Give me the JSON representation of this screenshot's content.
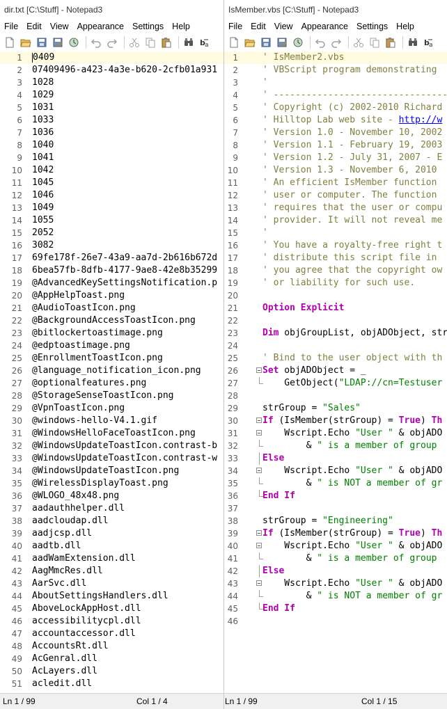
{
  "left": {
    "title": "dir.txt [C:\\Stuff] - Notepad3",
    "menu": [
      "File",
      "Edit",
      "View",
      "Appearance",
      "Settings",
      "Help"
    ],
    "status": {
      "line": "Ln 1 / 99",
      "col": "Col 1 / 4"
    },
    "lines": [
      {
        "n": "1",
        "t": "0409"
      },
      {
        "n": "2",
        "t": "07409496-a423-4a3e-b620-2cfb01a931"
      },
      {
        "n": "3",
        "t": "1028"
      },
      {
        "n": "4",
        "t": "1029"
      },
      {
        "n": "5",
        "t": "1031"
      },
      {
        "n": "6",
        "t": "1033"
      },
      {
        "n": "7",
        "t": "1036"
      },
      {
        "n": "8",
        "t": "1040"
      },
      {
        "n": "9",
        "t": "1041"
      },
      {
        "n": "10",
        "t": "1042"
      },
      {
        "n": "11",
        "t": "1045"
      },
      {
        "n": "12",
        "t": "1046"
      },
      {
        "n": "13",
        "t": "1049"
      },
      {
        "n": "14",
        "t": "1055"
      },
      {
        "n": "15",
        "t": "2052"
      },
      {
        "n": "16",
        "t": "3082"
      },
      {
        "n": "17",
        "t": "69fe178f-26e7-43a9-aa7d-2b616b672d"
      },
      {
        "n": "18",
        "t": "6bea57fb-8dfb-4177-9ae8-42e8b35299"
      },
      {
        "n": "19",
        "t": "@AdvancedKeySettingsNotification.p"
      },
      {
        "n": "20",
        "t": "@AppHelpToast.png"
      },
      {
        "n": "21",
        "t": "@AudioToastIcon.png"
      },
      {
        "n": "22",
        "t": "@BackgroundAccessToastIcon.png"
      },
      {
        "n": "23",
        "t": "@bitlockertoastimage.png"
      },
      {
        "n": "24",
        "t": "@edptoastimage.png"
      },
      {
        "n": "25",
        "t": "@EnrollmentToastIcon.png"
      },
      {
        "n": "26",
        "t": "@language_notification_icon.png"
      },
      {
        "n": "27",
        "t": "@optionalfeatures.png"
      },
      {
        "n": "28",
        "t": "@StorageSenseToastIcon.png"
      },
      {
        "n": "29",
        "t": "@VpnToastIcon.png"
      },
      {
        "n": "30",
        "t": "@windows-hello-V4.1.gif"
      },
      {
        "n": "31",
        "t": "@WindowsHelloFaceToastIcon.png"
      },
      {
        "n": "32",
        "t": "@WindowsUpdateToastIcon.contrast-b"
      },
      {
        "n": "33",
        "t": "@WindowsUpdateToastIcon.contrast-w"
      },
      {
        "n": "34",
        "t": "@WindowsUpdateToastIcon.png"
      },
      {
        "n": "35",
        "t": "@WirelessDisplayToast.png"
      },
      {
        "n": "36",
        "t": "@WLOGO_48x48.png"
      },
      {
        "n": "37",
        "t": "aadauthhelper.dll"
      },
      {
        "n": "38",
        "t": "aadcloudap.dll"
      },
      {
        "n": "39",
        "t": "aadjcsp.dll"
      },
      {
        "n": "40",
        "t": "aadtb.dll"
      },
      {
        "n": "41",
        "t": "aadWamExtension.dll"
      },
      {
        "n": "42",
        "t": "AagMmcRes.dll"
      },
      {
        "n": "43",
        "t": "AarSvc.dll"
      },
      {
        "n": "44",
        "t": "AboutSettingsHandlers.dll"
      },
      {
        "n": "45",
        "t": "AboveLockAppHost.dll"
      },
      {
        "n": "46",
        "t": "accessibilitycpl.dll"
      },
      {
        "n": "47",
        "t": "accountaccessor.dll"
      },
      {
        "n": "48",
        "t": "AccountsRt.dll"
      },
      {
        "n": "49",
        "t": "AcGenral.dll"
      },
      {
        "n": "50",
        "t": "AcLayers.dll"
      },
      {
        "n": "51",
        "t": "acledit.dll"
      }
    ]
  },
  "right": {
    "title": "IsMember.vbs [C:\\Stuff] - Notepad3",
    "menu": [
      "File",
      "Edit",
      "View",
      "Appearance",
      "Settings",
      "Help"
    ],
    "status": {
      "line": "Ln 1 / 99",
      "col": "Col 1 / 15"
    },
    "lines": [
      {
        "n": "1",
        "f": "",
        "segs": [
          {
            "c": "cmt",
            "t": "' IsMember2.vbs"
          }
        ]
      },
      {
        "n": "2",
        "f": "",
        "segs": [
          {
            "c": "cmt",
            "t": "' VBScript program demonstrating"
          }
        ]
      },
      {
        "n": "3",
        "f": "",
        "segs": [
          {
            "c": "cmt",
            "t": "'"
          }
        ]
      },
      {
        "n": "4",
        "f": "",
        "segs": [
          {
            "c": "cmt",
            "t": "' -----------------------------------"
          }
        ]
      },
      {
        "n": "5",
        "f": "",
        "segs": [
          {
            "c": "cmt",
            "t": "' Copyright (c) 2002-2010 Richard"
          }
        ]
      },
      {
        "n": "6",
        "f": "",
        "segs": [
          {
            "c": "cmt",
            "t": "' Hilltop Lab web site - "
          },
          {
            "c": "link",
            "t": "http://w"
          }
        ]
      },
      {
        "n": "7",
        "f": "",
        "segs": [
          {
            "c": "cmt",
            "t": "' Version 1.0 - November 10, 2002"
          }
        ]
      },
      {
        "n": "8",
        "f": "",
        "segs": [
          {
            "c": "cmt",
            "t": "' Version 1.1 - February 19, 2003"
          }
        ]
      },
      {
        "n": "9",
        "f": "",
        "segs": [
          {
            "c": "cmt",
            "t": "' Version 1.2 - July 31, 2007 - E"
          }
        ]
      },
      {
        "n": "10",
        "f": "",
        "segs": [
          {
            "c": "cmt",
            "t": "' Version 1.3 - November 6, 2010"
          }
        ]
      },
      {
        "n": "11",
        "f": "",
        "segs": [
          {
            "c": "cmt",
            "t": "' An efficient IsMember function"
          }
        ]
      },
      {
        "n": "12",
        "f": "",
        "segs": [
          {
            "c": "cmt",
            "t": "' user or computer. The function"
          }
        ]
      },
      {
        "n": "13",
        "f": "",
        "segs": [
          {
            "c": "cmt",
            "t": "' requires that the user or compu"
          }
        ]
      },
      {
        "n": "14",
        "f": "",
        "segs": [
          {
            "c": "cmt",
            "t": "' provider. It will not reveal me"
          }
        ]
      },
      {
        "n": "15",
        "f": "",
        "segs": [
          {
            "c": "cmt",
            "t": "'"
          }
        ]
      },
      {
        "n": "16",
        "f": "",
        "segs": [
          {
            "c": "cmt",
            "t": "' You have a royalty-free right t"
          }
        ]
      },
      {
        "n": "17",
        "f": "",
        "segs": [
          {
            "c": "cmt",
            "t": "' distribute this script file in"
          }
        ]
      },
      {
        "n": "18",
        "f": "",
        "segs": [
          {
            "c": "cmt",
            "t": "' you agree that the copyright ow"
          }
        ]
      },
      {
        "n": "19",
        "f": "",
        "segs": [
          {
            "c": "cmt",
            "t": "' or liability for such use."
          }
        ]
      },
      {
        "n": "20",
        "f": "",
        "segs": []
      },
      {
        "n": "21",
        "f": "",
        "segs": [
          {
            "c": "kw",
            "t": "Option Explicit"
          }
        ]
      },
      {
        "n": "22",
        "f": "",
        "segs": []
      },
      {
        "n": "23",
        "f": "",
        "segs": [
          {
            "c": "kw",
            "t": "Dim"
          },
          {
            "c": "",
            "t": " objGroupList, objADObject, str"
          }
        ]
      },
      {
        "n": "24",
        "f": "",
        "segs": []
      },
      {
        "n": "25",
        "f": "",
        "segs": [
          {
            "c": "cmt",
            "t": "' Bind to the user object with th"
          }
        ]
      },
      {
        "n": "26",
        "f": "box",
        "segs": [
          {
            "c": "kw",
            "t": "Set"
          },
          {
            "c": "",
            "t": " objADObject = _"
          }
        ]
      },
      {
        "n": "27",
        "f": "end",
        "segs": [
          {
            "c": "",
            "t": "    GetObject("
          },
          {
            "c": "str",
            "t": "\"LDAP://cn=Testuser"
          }
        ]
      },
      {
        "n": "28",
        "f": "",
        "segs": []
      },
      {
        "n": "29",
        "f": "",
        "segs": [
          {
            "c": "",
            "t": "strGroup = "
          },
          {
            "c": "str",
            "t": "\"Sales\""
          }
        ]
      },
      {
        "n": "30",
        "f": "box",
        "segs": [
          {
            "c": "kw",
            "t": "If"
          },
          {
            "c": "",
            "t": " (IsMember(strGroup) = "
          },
          {
            "c": "kw",
            "t": "True"
          },
          {
            "c": "",
            "t": ") "
          },
          {
            "c": "kw",
            "t": "Th"
          }
        ]
      },
      {
        "n": "31",
        "f": "box",
        "segs": [
          {
            "c": "",
            "t": "    Wscript.Echo "
          },
          {
            "c": "str",
            "t": "\"User \""
          },
          {
            "c": "",
            "t": " & objADO"
          }
        ]
      },
      {
        "n": "32",
        "f": "end",
        "segs": [
          {
            "c": "",
            "t": "        & "
          },
          {
            "c": "str",
            "t": "\" is a member of group"
          }
        ]
      },
      {
        "n": "33",
        "f": "line",
        "segs": [
          {
            "c": "kw",
            "t": "Else"
          }
        ]
      },
      {
        "n": "34",
        "f": "box",
        "segs": [
          {
            "c": "",
            "t": "    Wscript.Echo "
          },
          {
            "c": "str",
            "t": "\"User \""
          },
          {
            "c": "",
            "t": " & objADO"
          }
        ]
      },
      {
        "n": "35",
        "f": "end",
        "segs": [
          {
            "c": "",
            "t": "        & "
          },
          {
            "c": "str",
            "t": "\" is NOT a member of gr"
          }
        ]
      },
      {
        "n": "36",
        "f": "end",
        "segs": [
          {
            "c": "kw",
            "t": "End If"
          }
        ]
      },
      {
        "n": "37",
        "f": "",
        "segs": []
      },
      {
        "n": "38",
        "f": "",
        "segs": [
          {
            "c": "",
            "t": "strGroup = "
          },
          {
            "c": "str",
            "t": "\"Engineering\""
          }
        ]
      },
      {
        "n": "39",
        "f": "box",
        "segs": [
          {
            "c": "kw",
            "t": "If"
          },
          {
            "c": "",
            "t": " (IsMember(strGroup) = "
          },
          {
            "c": "kw",
            "t": "True"
          },
          {
            "c": "",
            "t": ") "
          },
          {
            "c": "kw",
            "t": "Th"
          }
        ]
      },
      {
        "n": "40",
        "f": "box",
        "segs": [
          {
            "c": "",
            "t": "    Wscript.Echo "
          },
          {
            "c": "str",
            "t": "\"User \""
          },
          {
            "c": "",
            "t": " & objADO"
          }
        ]
      },
      {
        "n": "41",
        "f": "end",
        "segs": [
          {
            "c": "",
            "t": "        & "
          },
          {
            "c": "str",
            "t": "\" is a member of group"
          }
        ]
      },
      {
        "n": "42",
        "f": "line",
        "segs": [
          {
            "c": "kw",
            "t": "Else"
          }
        ]
      },
      {
        "n": "43",
        "f": "box",
        "segs": [
          {
            "c": "",
            "t": "    Wscript.Echo "
          },
          {
            "c": "str",
            "t": "\"User \""
          },
          {
            "c": "",
            "t": " & objADO"
          }
        ]
      },
      {
        "n": "44",
        "f": "end",
        "segs": [
          {
            "c": "",
            "t": "        & "
          },
          {
            "c": "str",
            "t": "\" is NOT a member of gr"
          }
        ]
      },
      {
        "n": "45",
        "f": "end",
        "segs": [
          {
            "c": "kw",
            "t": "End If"
          }
        ]
      },
      {
        "n": "46",
        "f": "",
        "segs": []
      }
    ]
  },
  "toolbar_icons": [
    "new-file",
    "open-folder",
    "save",
    "save-as",
    "browse",
    "undo",
    "redo",
    "cut",
    "copy",
    "paste",
    "find",
    "replace"
  ],
  "colors": {
    "comment": "#808040",
    "keyword": "#b000b0",
    "string": "#008000",
    "link": "#0000ff",
    "current_line": "#fffbe0"
  }
}
